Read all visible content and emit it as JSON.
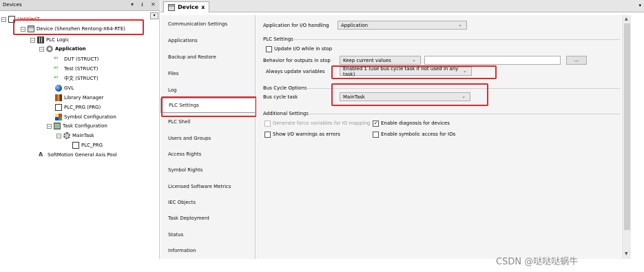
{
  "devices_panel": {
    "title": "Devices",
    "buttons": [
      "▾",
      "ᵻ",
      "✕"
    ],
    "tree": [
      {
        "label": "Untitled7",
        "icon": "project-icon"
      },
      {
        "label": "Device (Shenzhen Rentong-X64-RTE)",
        "icon": "device-icon"
      },
      {
        "label": "PLC Logic",
        "icon": "plc-logic-icon"
      },
      {
        "label": "Application",
        "icon": "application-icon"
      },
      {
        "label": "DUT (STRUCT)",
        "icon": "struct-icon"
      },
      {
        "label": "Test (STRUCT)",
        "icon": "struct-icon"
      },
      {
        "label": "中文 (STRUCT)",
        "icon": "struct-icon"
      },
      {
        "label": "GVL",
        "icon": "gvl-icon"
      },
      {
        "label": "Library Manager",
        "icon": "library-icon"
      },
      {
        "label": "PLC_PRG (PRG)",
        "icon": "program-icon"
      },
      {
        "label": "Symbol Configuration",
        "icon": "symbol-config-icon"
      },
      {
        "label": "Task Configuration",
        "icon": "task-config-icon"
      },
      {
        "label": "MainTask",
        "icon": "task-icon"
      },
      {
        "label": "PLC_PRG",
        "icon": "program-call-icon"
      },
      {
        "label": "SoftMotion General Axis Pool",
        "icon": "axis-pool-icon"
      }
    ]
  },
  "editor": {
    "tab_label": "Device",
    "tab_close": "x",
    "nav_items": [
      "Communication Settings",
      "Applications",
      "Backup and Restore",
      "Files",
      "Log",
      "PLC Settings",
      "PLC Shell",
      "Users and Groups",
      "Access Rights",
      "Symbol Rights",
      "Licensed Software Metrics",
      "IEC Objects",
      "Task Deployment",
      "Status",
      "Information"
    ],
    "active_nav": "PLC Settings"
  },
  "settings": {
    "app_io_label": "Application for I/O handling",
    "app_io_value": "Application",
    "plc_settings_header": "PLC Settings",
    "update_io_label": "Update I/O while in stop",
    "behavior_label": "Behavior for outputs in stop",
    "behavior_value": "Keep current values",
    "browse_button": "...",
    "always_update_label": "Always update variables",
    "always_update_value": "Enabled 1 (use bus cycle task if not used in any task)",
    "bus_cycle_header": "Bus Cycle Options",
    "bus_cycle_label": "Bus cycle task",
    "bus_cycle_value": "MainTask",
    "additional_header": "Additional Settings",
    "force_vars_label": "Generate force variables for IO mapping",
    "enable_diag_label": "Enable diagnosis for devices",
    "show_io_warn_label": "Show I/O warnings as errors",
    "symbolic_access_label": "Enable symbolic access for IOs",
    "enable_diag_checked": "✓"
  },
  "watermark": "CSDN @哒哒哒蜗牛"
}
